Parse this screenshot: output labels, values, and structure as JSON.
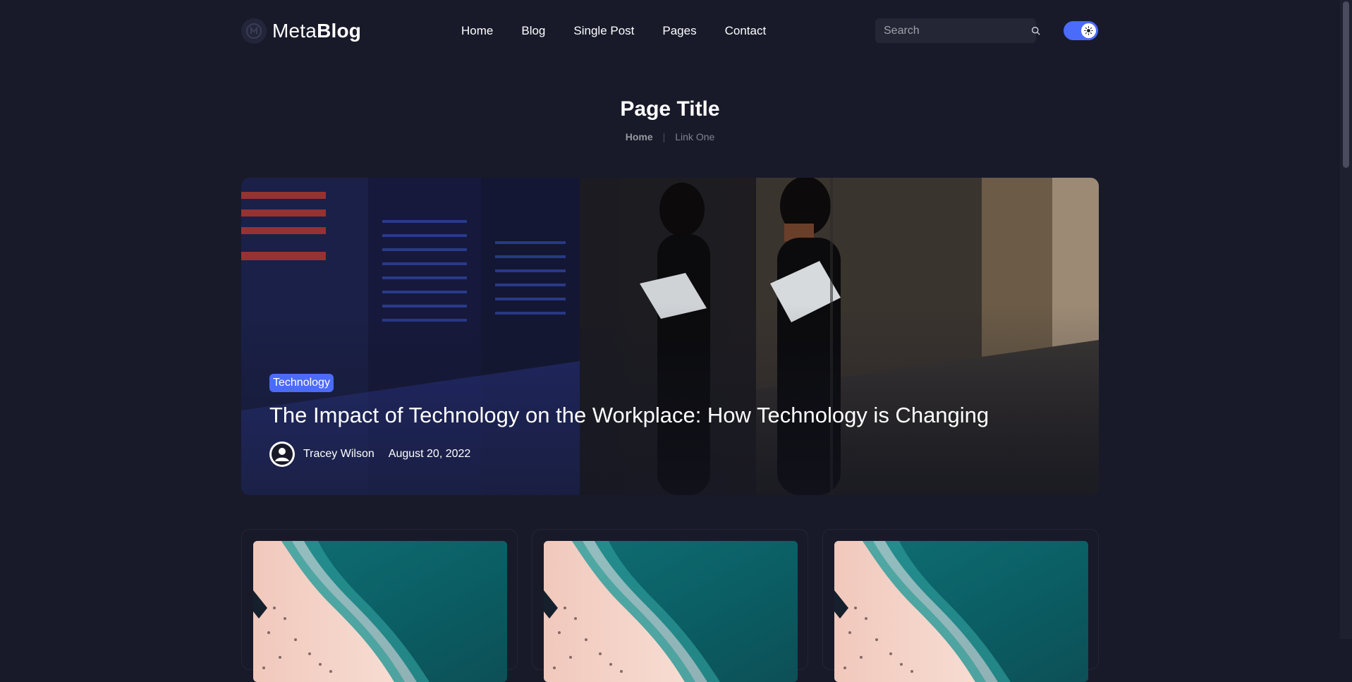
{
  "header": {
    "logo_light": "Meta",
    "logo_bold": "Blog",
    "nav": [
      {
        "label": "Home"
      },
      {
        "label": "Blog"
      },
      {
        "label": "Single Post"
      },
      {
        "label": "Pages"
      },
      {
        "label": "Contact"
      }
    ],
    "search_placeholder": "Search",
    "theme_toggle": "on"
  },
  "page": {
    "title": "Page Title",
    "breadcrumb": [
      "Home",
      "Link One"
    ]
  },
  "hero": {
    "category": "Technology",
    "title": "The Impact of Technology on the Workplace: How Technology is Changing",
    "author": "Tracey Wilson",
    "date": "August 20, 2022"
  },
  "cards": [
    {
      "image": "beach-aerial"
    },
    {
      "image": "beach-aerial"
    },
    {
      "image": "beach-aerial"
    }
  ],
  "colors": {
    "background": "#181a2a",
    "accent": "#4b6bfb",
    "surface": "#242535",
    "text": "#ffffff",
    "muted": "#97989f"
  }
}
